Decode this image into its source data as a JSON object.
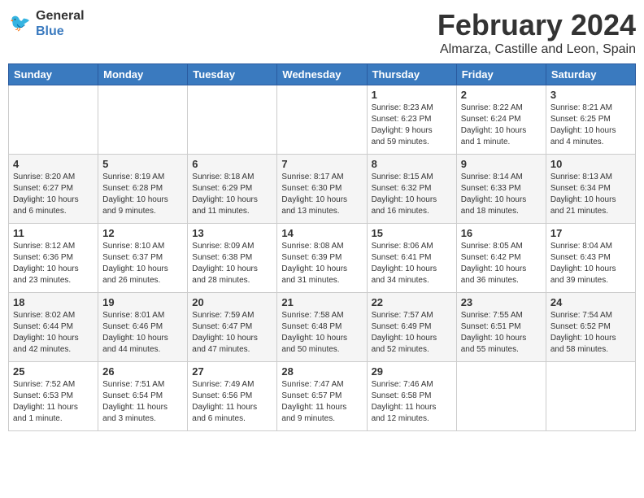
{
  "header": {
    "logo_line1": "General",
    "logo_line2": "Blue",
    "title": "February 2024",
    "subtitle": "Almarza, Castille and Leon, Spain"
  },
  "days_of_week": [
    "Sunday",
    "Monday",
    "Tuesday",
    "Wednesday",
    "Thursday",
    "Friday",
    "Saturday"
  ],
  "weeks": [
    [
      {
        "day": "",
        "info": ""
      },
      {
        "day": "",
        "info": ""
      },
      {
        "day": "",
        "info": ""
      },
      {
        "day": "",
        "info": ""
      },
      {
        "day": "1",
        "info": "Sunrise: 8:23 AM\nSunset: 6:23 PM\nDaylight: 9 hours\nand 59 minutes."
      },
      {
        "day": "2",
        "info": "Sunrise: 8:22 AM\nSunset: 6:24 PM\nDaylight: 10 hours\nand 1 minute."
      },
      {
        "day": "3",
        "info": "Sunrise: 8:21 AM\nSunset: 6:25 PM\nDaylight: 10 hours\nand 4 minutes."
      }
    ],
    [
      {
        "day": "4",
        "info": "Sunrise: 8:20 AM\nSunset: 6:27 PM\nDaylight: 10 hours\nand 6 minutes."
      },
      {
        "day": "5",
        "info": "Sunrise: 8:19 AM\nSunset: 6:28 PM\nDaylight: 10 hours\nand 9 minutes."
      },
      {
        "day": "6",
        "info": "Sunrise: 8:18 AM\nSunset: 6:29 PM\nDaylight: 10 hours\nand 11 minutes."
      },
      {
        "day": "7",
        "info": "Sunrise: 8:17 AM\nSunset: 6:30 PM\nDaylight: 10 hours\nand 13 minutes."
      },
      {
        "day": "8",
        "info": "Sunrise: 8:15 AM\nSunset: 6:32 PM\nDaylight: 10 hours\nand 16 minutes."
      },
      {
        "day": "9",
        "info": "Sunrise: 8:14 AM\nSunset: 6:33 PM\nDaylight: 10 hours\nand 18 minutes."
      },
      {
        "day": "10",
        "info": "Sunrise: 8:13 AM\nSunset: 6:34 PM\nDaylight: 10 hours\nand 21 minutes."
      }
    ],
    [
      {
        "day": "11",
        "info": "Sunrise: 8:12 AM\nSunset: 6:36 PM\nDaylight: 10 hours\nand 23 minutes."
      },
      {
        "day": "12",
        "info": "Sunrise: 8:10 AM\nSunset: 6:37 PM\nDaylight: 10 hours\nand 26 minutes."
      },
      {
        "day": "13",
        "info": "Sunrise: 8:09 AM\nSunset: 6:38 PM\nDaylight: 10 hours\nand 28 minutes."
      },
      {
        "day": "14",
        "info": "Sunrise: 8:08 AM\nSunset: 6:39 PM\nDaylight: 10 hours\nand 31 minutes."
      },
      {
        "day": "15",
        "info": "Sunrise: 8:06 AM\nSunset: 6:41 PM\nDaylight: 10 hours\nand 34 minutes."
      },
      {
        "day": "16",
        "info": "Sunrise: 8:05 AM\nSunset: 6:42 PM\nDaylight: 10 hours\nand 36 minutes."
      },
      {
        "day": "17",
        "info": "Sunrise: 8:04 AM\nSunset: 6:43 PM\nDaylight: 10 hours\nand 39 minutes."
      }
    ],
    [
      {
        "day": "18",
        "info": "Sunrise: 8:02 AM\nSunset: 6:44 PM\nDaylight: 10 hours\nand 42 minutes."
      },
      {
        "day": "19",
        "info": "Sunrise: 8:01 AM\nSunset: 6:46 PM\nDaylight: 10 hours\nand 44 minutes."
      },
      {
        "day": "20",
        "info": "Sunrise: 7:59 AM\nSunset: 6:47 PM\nDaylight: 10 hours\nand 47 minutes."
      },
      {
        "day": "21",
        "info": "Sunrise: 7:58 AM\nSunset: 6:48 PM\nDaylight: 10 hours\nand 50 minutes."
      },
      {
        "day": "22",
        "info": "Sunrise: 7:57 AM\nSunset: 6:49 PM\nDaylight: 10 hours\nand 52 minutes."
      },
      {
        "day": "23",
        "info": "Sunrise: 7:55 AM\nSunset: 6:51 PM\nDaylight: 10 hours\nand 55 minutes."
      },
      {
        "day": "24",
        "info": "Sunrise: 7:54 AM\nSunset: 6:52 PM\nDaylight: 10 hours\nand 58 minutes."
      }
    ],
    [
      {
        "day": "25",
        "info": "Sunrise: 7:52 AM\nSunset: 6:53 PM\nDaylight: 11 hours\nand 1 minute."
      },
      {
        "day": "26",
        "info": "Sunrise: 7:51 AM\nSunset: 6:54 PM\nDaylight: 11 hours\nand 3 minutes."
      },
      {
        "day": "27",
        "info": "Sunrise: 7:49 AM\nSunset: 6:56 PM\nDaylight: 11 hours\nand 6 minutes."
      },
      {
        "day": "28",
        "info": "Sunrise: 7:47 AM\nSunset: 6:57 PM\nDaylight: 11 hours\nand 9 minutes."
      },
      {
        "day": "29",
        "info": "Sunrise: 7:46 AM\nSunset: 6:58 PM\nDaylight: 11 hours\nand 12 minutes."
      },
      {
        "day": "",
        "info": ""
      },
      {
        "day": "",
        "info": ""
      }
    ]
  ]
}
